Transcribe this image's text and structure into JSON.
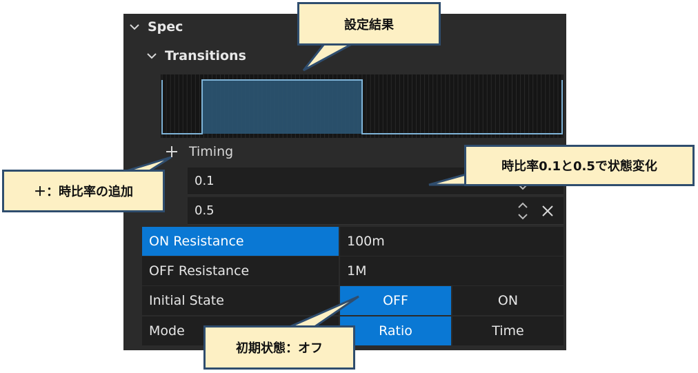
{
  "panel": {
    "section_spec": "Spec",
    "section_transitions": "Transitions",
    "timing_label": "Timing",
    "timing_values": [
      "0.1",
      "0.5"
    ],
    "waveform": {
      "low_to_high_at": 0.1,
      "high_to_low_at": 0.5
    },
    "properties": [
      {
        "label": "ON Resistance",
        "value": "100m",
        "selected": true
      },
      {
        "label": "OFF Resistance",
        "value": "1M"
      }
    ],
    "initial_state": {
      "label": "Initial State",
      "options": [
        "OFF",
        "ON"
      ],
      "selected": "OFF"
    },
    "mode": {
      "label": "Mode",
      "options": [
        "Ratio",
        "Time"
      ],
      "selected": "Ratio"
    }
  },
  "callouts": {
    "result": "設定結果",
    "ratio_change": "時比率0.1と0.5で状態変化",
    "add_ratio": "＋：時比率の追加",
    "initial_off": "初期状態：オフ"
  },
  "colors": {
    "panel_bg": "#2b2b2b",
    "accent": "#0a78d4",
    "callout_fill": "#fdf0c4",
    "callout_border": "#2f4d6e",
    "wave_line": "#7fb4d8"
  }
}
